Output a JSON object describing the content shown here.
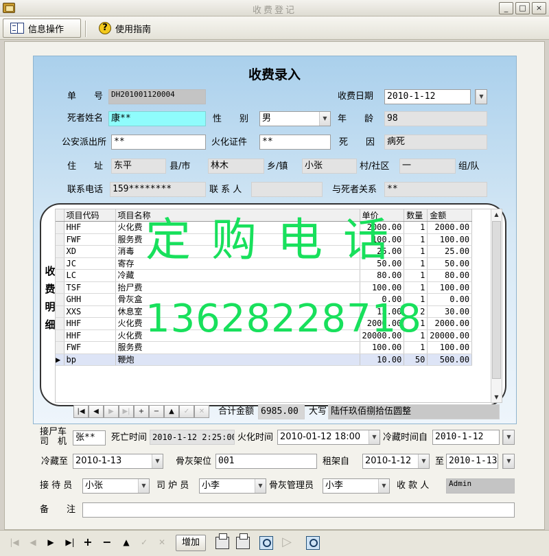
{
  "window": {
    "title": "收费登记",
    "minimize": "_",
    "maximize": "□",
    "close": "×"
  },
  "menu": {
    "info_ops": "信息操作",
    "guide": "使用指南"
  },
  "form": {
    "heading": "收费录入",
    "doc_no_label": "单　　号",
    "doc_no": "DH201001120004",
    "charge_date_label": "收费日期",
    "charge_date": "2010-1-12",
    "deceased_label": "死者姓名",
    "deceased": "康**",
    "gender_label": "性　　别",
    "gender": "男",
    "age_label": "年　　龄",
    "age": "98",
    "police_label": "公安派出所",
    "police": "**",
    "cert_label": "火化证件",
    "cert": "**",
    "death_cause_label": "死　　因",
    "death_cause": "病死",
    "address_label": "住　　址",
    "county": "东平",
    "county_label": "县/市",
    "town": "林木",
    "town_label": "乡/镇",
    "village": "小张",
    "village_label": "村/社区",
    "group": "一",
    "group_label": "组/队",
    "phone_label": "联系电话",
    "phone": "159********",
    "contact_label": "联 系 人",
    "contact": "",
    "relation_label": "与死者关系",
    "relation": "**"
  },
  "detail": {
    "side_label": [
      "收",
      "费",
      "明",
      "细"
    ],
    "columns": [
      "项目代码",
      "项目名称",
      "单价",
      "数量",
      "金额"
    ],
    "rows": [
      [
        "HHF",
        "火化费",
        "2000.00",
        "1",
        "2000.00"
      ],
      [
        "FWF",
        "服务费",
        "100.00",
        "1",
        "100.00"
      ],
      [
        "XD",
        "消毒",
        "25.00",
        "1",
        "25.00"
      ],
      [
        "JC",
        "寄存",
        "50.00",
        "1",
        "50.00"
      ],
      [
        "LC",
        "冷藏",
        "80.00",
        "1",
        "80.00"
      ],
      [
        "TSF",
        "抬尸费",
        "100.00",
        "1",
        "100.00"
      ],
      [
        "GHH",
        "骨灰盒",
        "0.00",
        "1",
        "0.00"
      ],
      [
        "XXS",
        "休息室",
        "15.00",
        "2",
        "30.00"
      ],
      [
        "HHF",
        "火化费",
        "2000.00",
        "1",
        "2000.00"
      ],
      [
        "HHF",
        "火化费",
        "20000.00",
        "1",
        "20000.00"
      ],
      [
        "FWF",
        "服务费",
        "100.00",
        "1",
        "100.00"
      ],
      [
        "bp",
        "鞭炮",
        "10.00",
        "50",
        "500.00"
      ]
    ],
    "total_label": "合计金额",
    "total": "6985.00",
    "upper_label": "大写",
    "upper": "陆仟玖佰捌拾伍圆整",
    "nav": [
      "|◀",
      "◀",
      "▶",
      "▶|",
      "+",
      "−",
      "▲",
      "✓",
      "✕"
    ]
  },
  "lower": {
    "driver_label_1": "接尸车",
    "driver_label_2": "司　机",
    "driver": "张**",
    "death_time_label": "死亡时间",
    "death_time": "2010-1-12 2:25:00",
    "cremation_time_label": "火化时间",
    "cremation_time": "2010-01-12 18:00",
    "cold_from_label": "冷藏时间自",
    "cold_from": "2010-1-12",
    "cold_to_label": "冷藏至",
    "cold_to": "2010-1-13",
    "rack_label": "骨灰架位",
    "rack": "001",
    "rent_from_label": "租架自",
    "rent_from": "2010-1-12",
    "rent_to_label": "至",
    "rent_to": "2010-1-13",
    "receptionist_label": "接 待 员",
    "receptionist": "小张",
    "furnace_label": "司 炉 员",
    "furnace": "小李",
    "ash_admin_label": "骨灰管理员",
    "ash_admin": "小李",
    "cashier_label": "收 款 人",
    "cashier": "Admin",
    "remark_label": "备　　注",
    "remark": ""
  },
  "watermark": {
    "line1": "定购电话",
    "line2": "13628228718"
  },
  "toolbar": {
    "first": "|◀",
    "prev": "◀",
    "next": "▶",
    "last": "▶|",
    "add": "+",
    "delete": "−",
    "up": "▲",
    "confirm": "✓",
    "cancel": "✕",
    "add_label": "增加",
    "play": "▷"
  }
}
